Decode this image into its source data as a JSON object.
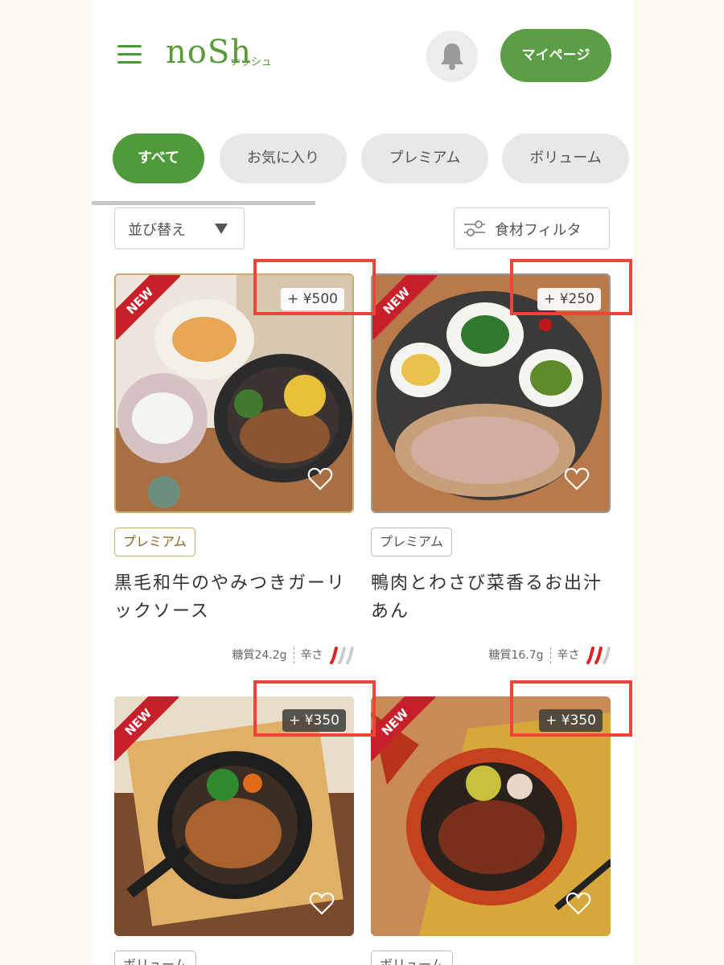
{
  "header": {
    "logo_main": "noSh",
    "logo_sub": "ナッシュ",
    "mypage_label": "マイページ"
  },
  "tabs": [
    {
      "label": "すべて",
      "active": true
    },
    {
      "label": "お気に入り",
      "active": false
    },
    {
      "label": "プレミアム",
      "active": false
    },
    {
      "label": "ボリューム",
      "active": false
    }
  ],
  "toolbar": {
    "sort_label": "並び替え",
    "filter_label": "食材フィルタ"
  },
  "products": [
    {
      "new_label": "NEW",
      "price": "+ ¥500",
      "category": "プレミアム",
      "name": "黒毛和牛のやみつきガーリックソース",
      "carbs": "糖質24.2g",
      "spice_label": "辛さ"
    },
    {
      "new_label": "NEW",
      "price": "+ ¥250",
      "category": "プレミアム",
      "name": "鴨肉とわさび菜香るお出汁あん",
      "carbs": "糖質16.7g",
      "spice_label": "辛さ"
    },
    {
      "new_label": "NEW",
      "price": "+ ¥350",
      "category": "ボリューム"
    },
    {
      "new_label": "NEW",
      "price": "+ ¥350",
      "category": "ボリューム"
    }
  ],
  "colors": {
    "brand_green": "#5b9e46",
    "highlight_red": "#ef4438",
    "new_ribbon_red": "#c8202a"
  }
}
